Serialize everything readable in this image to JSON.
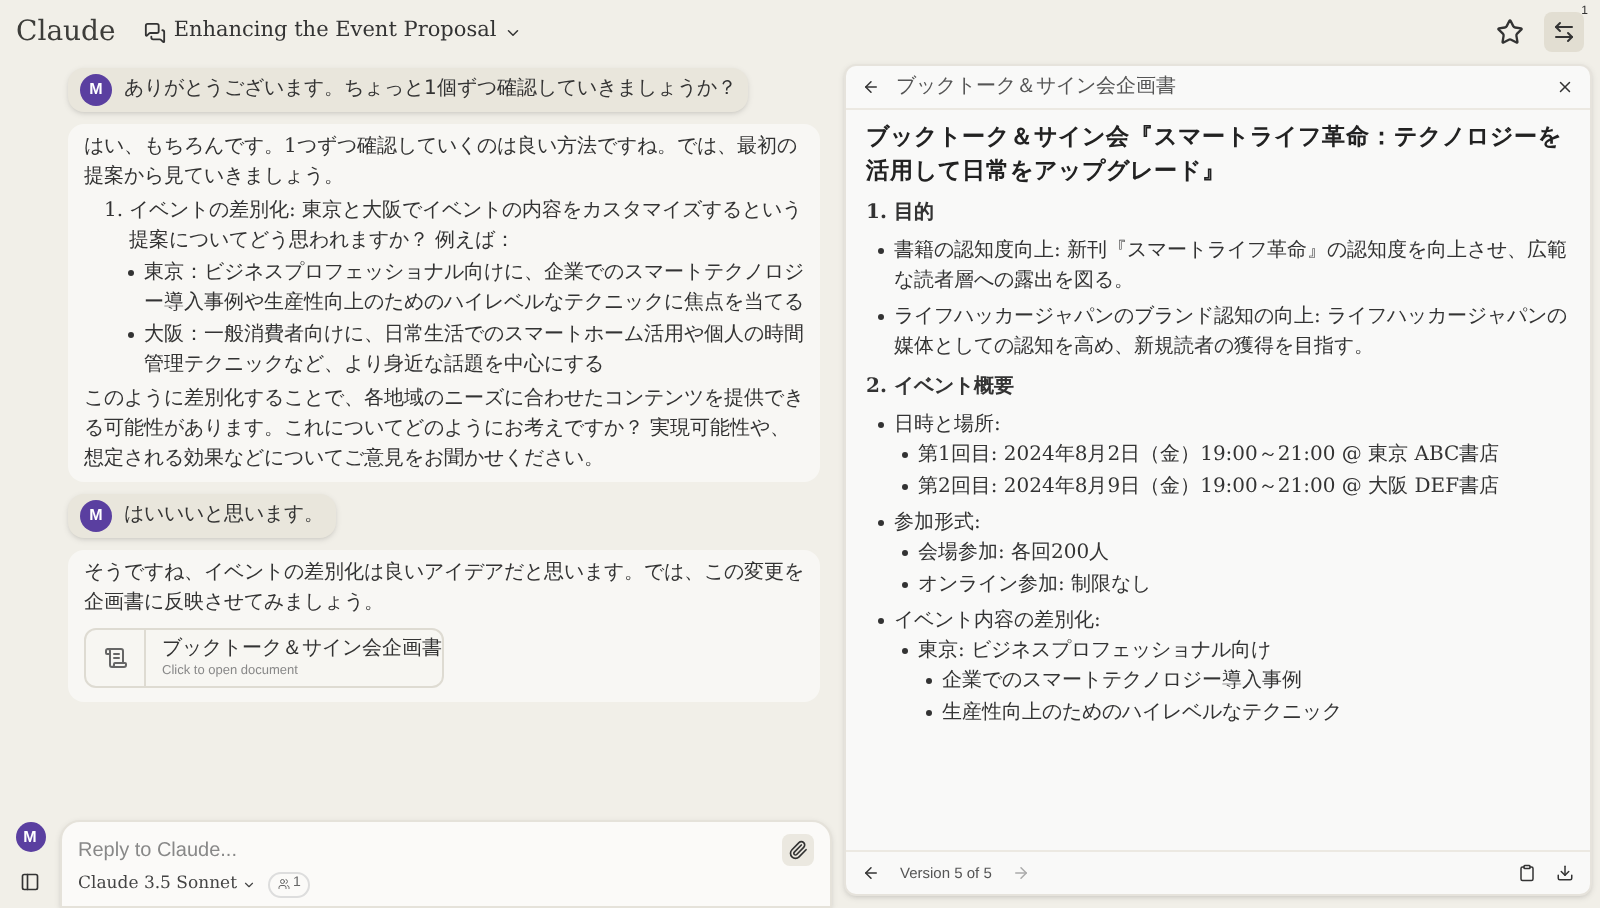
{
  "header": {
    "brand": "Claude",
    "conversation_title": "Enhancing the Event Proposal",
    "notification_count": "1"
  },
  "messages": [
    {
      "kind": "user",
      "avatar": "M",
      "text": "ありがとうございます。ちょっと1個ずつ確認していきましょうか？"
    },
    {
      "kind": "assistant",
      "blocks": [
        {
          "kind": "p",
          "text": "はい、もちろんです。1つずつ確認していくのは良い方法ですね。では、最初の提案から見ていきましょう。"
        },
        {
          "kind": "ol",
          "number": "1.",
          "text": "イベントの差別化: 東京と大阪でイベントの内容をカスタマイズするという提案についてどう思われますか？ 例えば：",
          "children": [
            "東京：ビジネスプロフェッショナル向けに、企業でのスマートテクノロジー導入事例や生産性向上のためのハイレベルなテクニックに焦点を当てる",
            "大阪：一般消費者向けに、日常生活でのスマートホーム活用や個人の時間管理テクニックなど、より身近な話題を中心にする"
          ]
        },
        {
          "kind": "p",
          "text": "このように差別化することで、各地域のニーズに合わせたコンテンツを提供できる可能性があります。これについてどのようにお考えですか？ 実現可能性や、想定される効果などについてご意見をお聞かせください。"
        }
      ]
    },
    {
      "kind": "user",
      "avatar": "M",
      "text": "はいいいと思います。"
    },
    {
      "kind": "assistant",
      "blocks": [
        {
          "kind": "p",
          "text": "そうですね、イベントの差別化は良いアイデアだと思います。では、この変更を企画書に反映させてみましょう。"
        },
        {
          "kind": "doc",
          "title": "ブックトーク＆サイン会企画書",
          "subtitle": "Click to open document"
        }
      ]
    }
  ],
  "composer": {
    "placeholder": "Reply to Claude...",
    "model": "Claude 3.5 Sonnet",
    "user_count": "1",
    "avatar": "M"
  },
  "document": {
    "title": "ブックトーク＆サイン会企画書",
    "heading": "ブックトーク＆サイン会『スマートライフ革命：テクノロジーを活用して日常をアップグレード』",
    "sections": [
      {
        "heading": "1. 目的",
        "items": [
          {
            "text": "書籍の認知度向上: 新刊『スマートライフ革命』の認知度を向上させ、広範な読者層への露出を図る。"
          },
          {
            "text": "ライフハッカージャパンのブランド認知の向上: ライフハッカージャパンの媒体としての認知を高め、新規読者の獲得を目指す。"
          }
        ]
      },
      {
        "heading": "2. イベント概要",
        "items": [
          {
            "text": "日時と場所:",
            "children": [
              {
                "text": "第1回目: 2024年8月2日（金）19:00～21:00 @ 東京 ABC書店"
              },
              {
                "text": "第2回目: 2024年8月9日（金）19:00～21:00 @ 大阪 DEF書店"
              }
            ]
          },
          {
            "text": "参加形式:",
            "children": [
              {
                "text": "会場参加: 各回200人"
              },
              {
                "text": "オンライン参加: 制限なし"
              }
            ]
          },
          {
            "text": "イベント内容の差別化:",
            "children": [
              {
                "text": "東京: ビジネスプロフェッショナル向け",
                "children": [
                  {
                    "text": "企業でのスマートテクノロジー導入事例"
                  },
                  {
                    "text": "生産性向上のためのハイレベルなテクニック"
                  }
                ]
              }
            ]
          }
        ]
      }
    ],
    "version": "Version 5 of 5"
  }
}
